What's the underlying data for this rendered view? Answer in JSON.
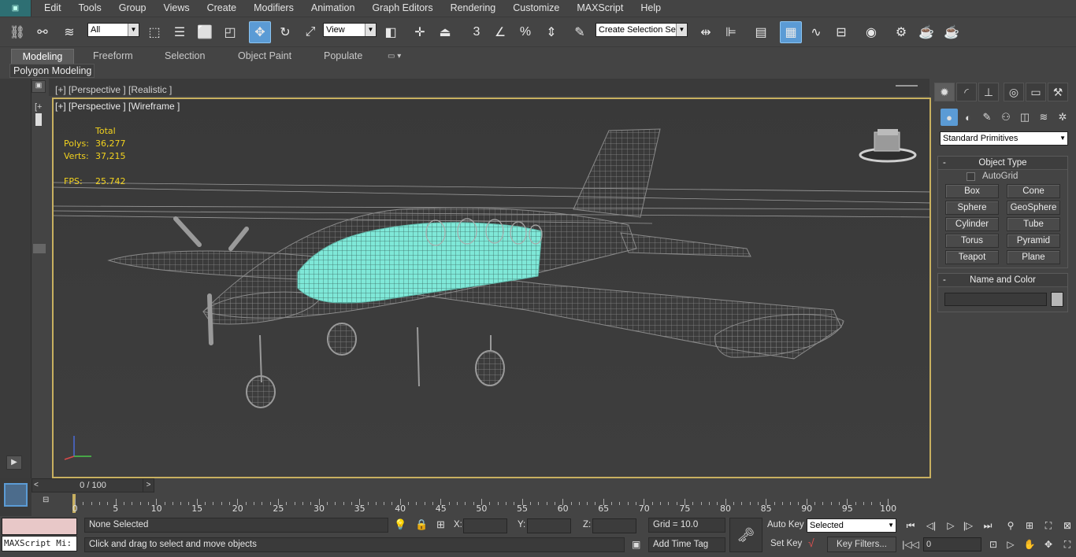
{
  "menu": {
    "items": [
      "Edit",
      "Tools",
      "Group",
      "Views",
      "Create",
      "Modifiers",
      "Animation",
      "Graph Editors",
      "Rendering",
      "Customize",
      "MAXScript",
      "Help"
    ]
  },
  "toolbar": {
    "selection_filter": "All",
    "reference_coord": "View",
    "named_selection_placeholder": "Create Selection Se"
  },
  "ribbon": {
    "tabs": [
      "Modeling",
      "Freeform",
      "Selection",
      "Object Paint",
      "Populate"
    ],
    "active_tab": "Modeling",
    "panel_label": "Polygon Modeling"
  },
  "viewport": {
    "label": "[+] [Perspective ] [Wireframe ]",
    "label_behind": "[+] [Perspective ] [Realistic ]",
    "stats": {
      "header": "Total",
      "polys_label": "Polys:",
      "polys_value": "36,277",
      "verts_label": "Verts:",
      "verts_value": "37,215",
      "fps_label": "FPS:",
      "fps_value": "25.742"
    },
    "colors": {
      "frame": "#c8b060",
      "wire": "#8a8a8a",
      "selected_wire": "#7fe8d8"
    }
  },
  "command_panel": {
    "category_dropdown": "Standard Primitives",
    "object_type": {
      "title": "Object Type",
      "autogrid_label": "AutoGrid",
      "buttons": [
        "Box",
        "Cone",
        "Sphere",
        "GeoSphere",
        "Cylinder",
        "Tube",
        "Torus",
        "Pyramid",
        "Teapot",
        "Plane"
      ]
    },
    "name_and_color": {
      "title": "Name and Color"
    }
  },
  "timeline": {
    "slider_text": "0 / 100",
    "ticks": [
      "0",
      "5",
      "10",
      "15",
      "20",
      "25",
      "30",
      "35",
      "40",
      "45",
      "50",
      "55",
      "60",
      "65",
      "70",
      "75",
      "80",
      "85",
      "90",
      "95",
      "100"
    ]
  },
  "status": {
    "maxscript_label": "MAXScript Mi:",
    "selection_text": "None Selected",
    "prompt_text": "Click and drag to select and move objects",
    "x_label": "X:",
    "y_label": "Y:",
    "z_label": "Z:",
    "grid_text": "Grid = 10.0",
    "add_time_tag": "Add Time Tag",
    "auto_key": "Auto Key",
    "set_key": "Set Key",
    "key_mode_select": "Selected",
    "key_filters": "Key Filters...",
    "current_frame": "0"
  }
}
